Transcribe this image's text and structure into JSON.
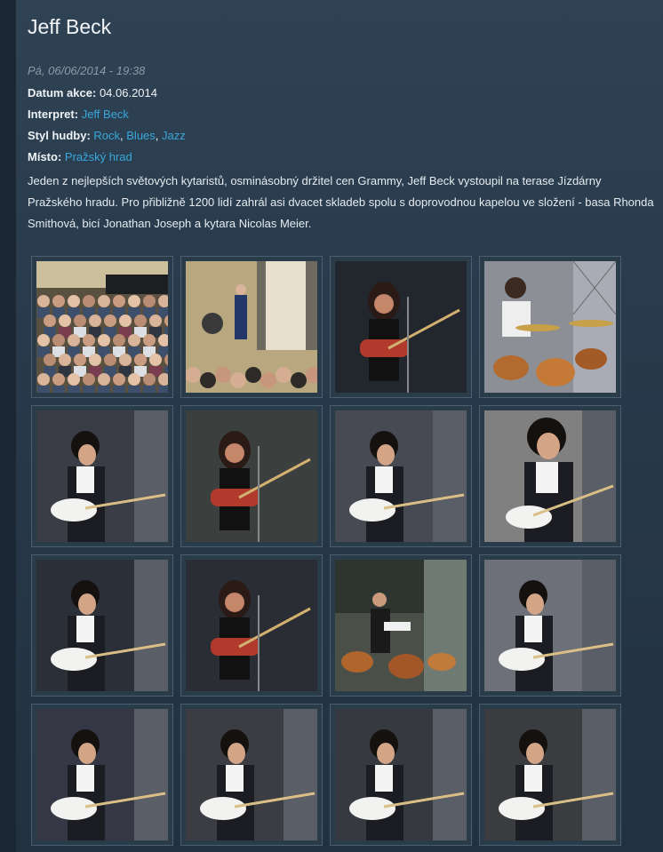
{
  "article": {
    "title": "Jeff Beck",
    "posted": "Pá, 06/06/2014 - 19:38",
    "fields": {
      "date_label": "Datum akce:",
      "date_value": "04.06.2014",
      "artist_label": "Interpret:",
      "artist_value": "Jeff Beck",
      "genre_label": "Styl hudby:",
      "genres": [
        "Rock",
        "Blues",
        "Jazz"
      ],
      "place_label": "Místo:",
      "place_value": "Pražský hrad"
    },
    "description": "Jeden z nejlepších světových kytaristů, osminásobný držitel cen Grammy, Jeff Beck vystoupil na terase Jízdárny Pražského hradu. Pro přibližně 1200 lidí zahrál asi dvacet skladeb spolu s doprovodnou kapelou ve složení - basa Rhonda Smithová, bicí Jonathan Joseph a kytara Nicolas Meier."
  },
  "gallery": {
    "photos": [
      {
        "scene": "crowd",
        "bg": "#5a5040"
      },
      {
        "scene": "gong-guard",
        "bg": "#b9a780"
      },
      {
        "scene": "bassist",
        "bg": "#22262d"
      },
      {
        "scene": "drummer",
        "bg": "#8c8f96"
      },
      {
        "scene": "guitarist",
        "bg": "#3a3d45"
      },
      {
        "scene": "bassist",
        "bg": "#3b3f3d"
      },
      {
        "scene": "guitarist",
        "bg": "#474a52"
      },
      {
        "scene": "guitarist-close",
        "bg": "#808080"
      },
      {
        "scene": "guitarist",
        "bg": "#2b2f38"
      },
      {
        "scene": "bassist",
        "bg": "#2a2d33"
      },
      {
        "scene": "stage-wide",
        "bg": "#4a4f48"
      },
      {
        "scene": "guitarist",
        "bg": "#6d7078"
      },
      {
        "scene": "guitarist",
        "bg": "#353844"
      },
      {
        "scene": "guitarist",
        "bg": "#3b3d42"
      },
      {
        "scene": "guitarist",
        "bg": "#363a40"
      },
      {
        "scene": "guitarist",
        "bg": "#3a3c3f"
      }
    ]
  }
}
